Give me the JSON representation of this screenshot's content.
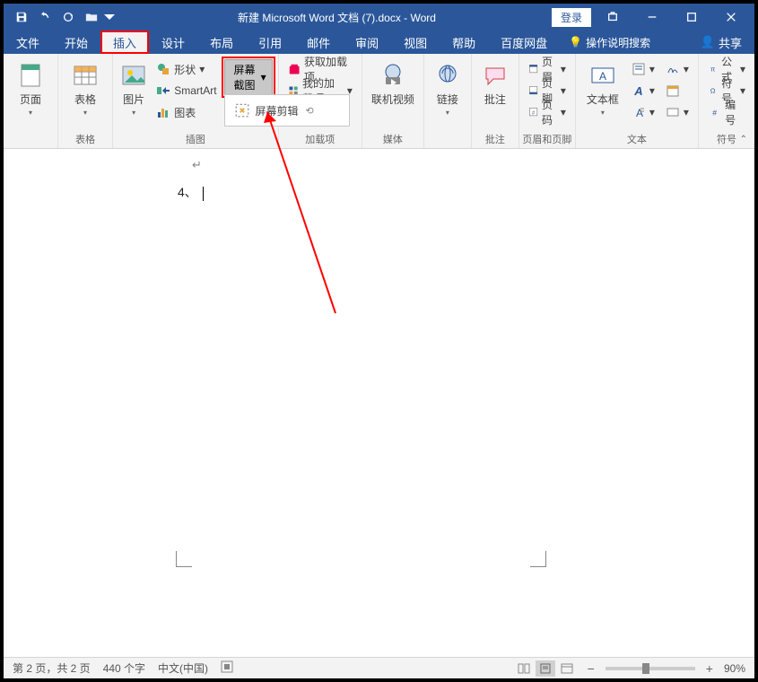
{
  "title": "新建 Microsoft Word 文档 (7).docx  -  Word",
  "login_label": "登录",
  "tabs": {
    "file": "文件",
    "home": "开始",
    "insert": "插入",
    "design": "设计",
    "layout": "布局",
    "references": "引用",
    "mailings": "邮件",
    "review": "审阅",
    "view": "视图",
    "help": "帮助",
    "baidu": "百度网盘",
    "tellme": "操作说明搜索"
  },
  "share_label": "共享",
  "ribbon": {
    "groups": {
      "pages": {
        "label": "页面",
        "cover": "页面"
      },
      "tables": {
        "label": "表格",
        "btn": "表格"
      },
      "illustrations": {
        "label": "插图",
        "picture": "图片",
        "shapes": "形状",
        "smartart": "SmartArt",
        "chart": "图表",
        "screenshot": "屏幕截图",
        "screen_clip": "屏幕剪辑"
      },
      "addins": {
        "label": "加载项",
        "get": "获取加载项",
        "my": "我的加载项"
      },
      "media": {
        "label": "媒体",
        "video": "联机视频"
      },
      "links": {
        "label": "",
        "link": "链接"
      },
      "comments": {
        "label": "批注",
        "comment": "批注"
      },
      "headerfooter": {
        "label": "页眉和页脚",
        "header": "页眉",
        "footer": "页脚",
        "pagenum": "页码"
      },
      "text": {
        "label": "文本",
        "textbox": "文本框"
      },
      "symbols": {
        "label": "符号",
        "equation": "公式",
        "symbol": "符号",
        "number": "编号"
      }
    }
  },
  "document": {
    "line1": "4、"
  },
  "status": {
    "page": "第 2 页，共 2 页",
    "words": "440 个字",
    "lang": "中文(中国)",
    "zoom": "90%"
  }
}
